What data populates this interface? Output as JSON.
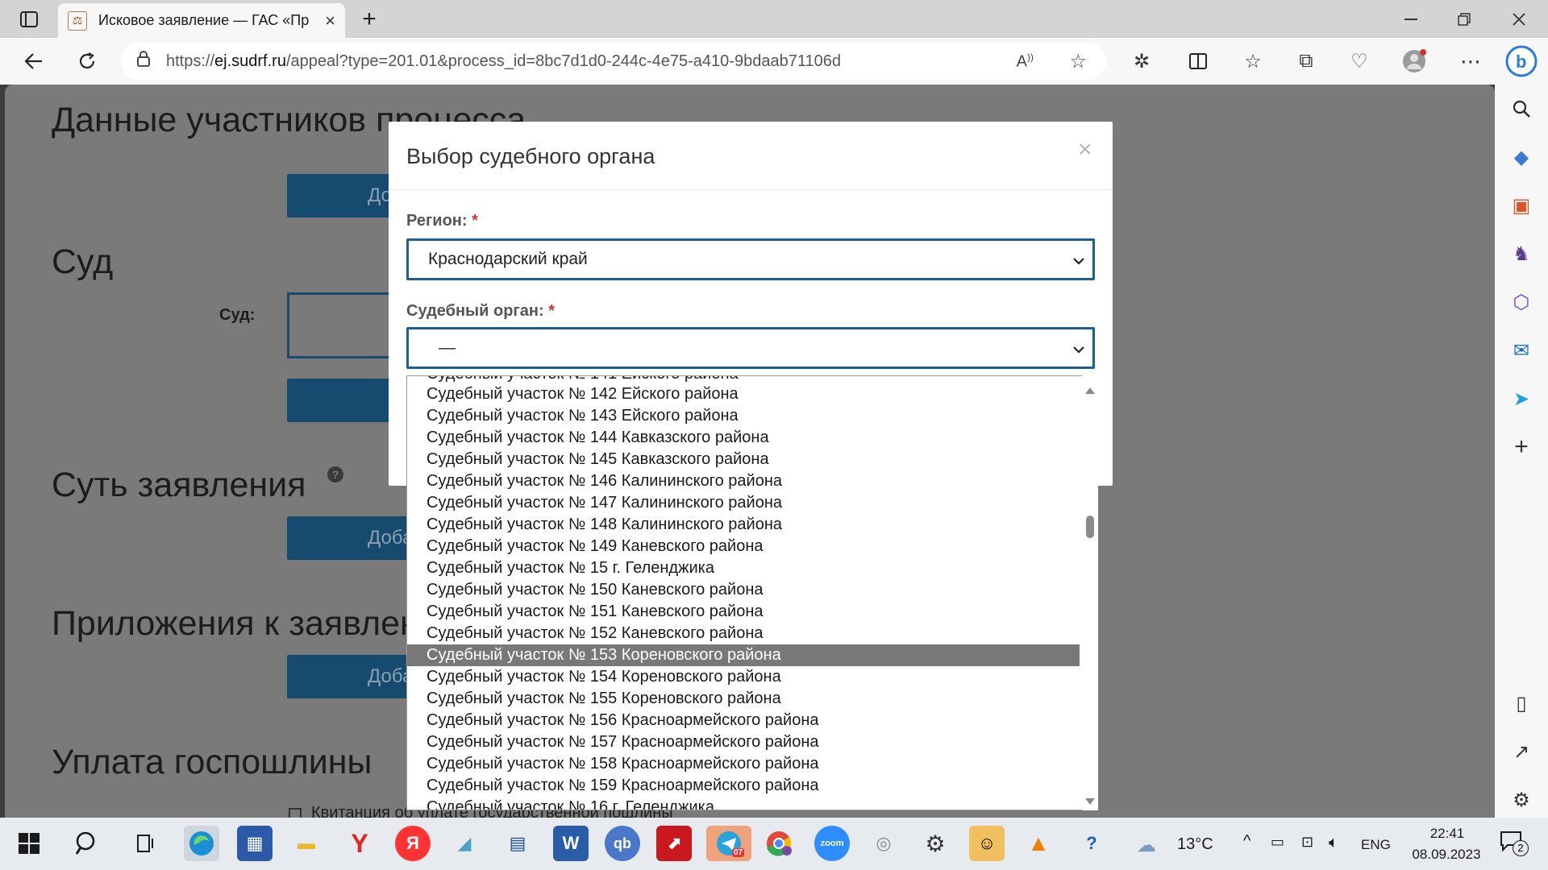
{
  "browser": {
    "tab_title": "Исковое заявление — ГАС «Пр",
    "tab_close": "×",
    "new_tab": "+",
    "url_prefix": "https://",
    "url_host": "ej.sudrf.ru",
    "url_path": "/appeal?type=201.01&process_id=8bc7d1d0-244c-4e75-a410-9bdaab71106d",
    "window_controls": [
      "minimize-icon",
      "restore-icon",
      "close-icon"
    ]
  },
  "page": {
    "section_participants": "Данные участников процесса",
    "section_court": "Суд",
    "court_label": "Суд:",
    "section_essence": "Суть заявления",
    "section_attachments": "Приложения к заявлению",
    "section_fee": "Уплата госпошлины",
    "add_button": "Добавить",
    "fee_checkbox_label": "Квитанция об уплате государственной пошлины"
  },
  "modal": {
    "title": "Выбор судебного органа",
    "close": "×",
    "region_label": "Регион:",
    "required_mark": "*",
    "region_value": "Краснодарский край",
    "court_label": "Судебный орган:",
    "court_value": "—"
  },
  "dropdown": {
    "partial_top": "Судебный участок № 141 Ейского района",
    "options": [
      "Судебный участок № 142 Ейского района",
      "Судебный участок № 143 Ейского района",
      "Судебный участок № 144 Кавказского района",
      "Судебный участок № 145 Кавказского района",
      "Судебный участок № 146 Калининского района",
      "Судебный участок № 147 Калининского района",
      "Судебный участок № 148 Калининского района",
      "Судебный участок № 149 Каневского района",
      "Судебный участок № 15 г. Геленджика",
      "Судебный участок № 150 Каневского района",
      "Судебный участок № 151 Каневского района",
      "Судебный участок № 152 Каневского района",
      "Судебный участок № 153 Кореновского района",
      "Судебный участок № 154 Кореновского района",
      "Судебный участок № 155 Кореновского района",
      "Судебный участок № 156 Красноармейского района",
      "Судебный участок № 157 Красноармейского района",
      "Судебный участок № 158 Красноармейского района",
      "Судебный участок № 159 Красноармейского района",
      "Судебный участок № 16 г. Геленджика"
    ],
    "highlighted_index": 12
  },
  "taskbar": {
    "weather_temp": "13°C",
    "language": "ENG",
    "time": "22:41",
    "date": "08.09.2023",
    "notification_count": "2",
    "telegram_badge": "07"
  },
  "colors": {
    "accent": "#1f5f8b",
    "page_button": "#164a6e",
    "highlight": "#787878",
    "required": "#c0392b"
  }
}
